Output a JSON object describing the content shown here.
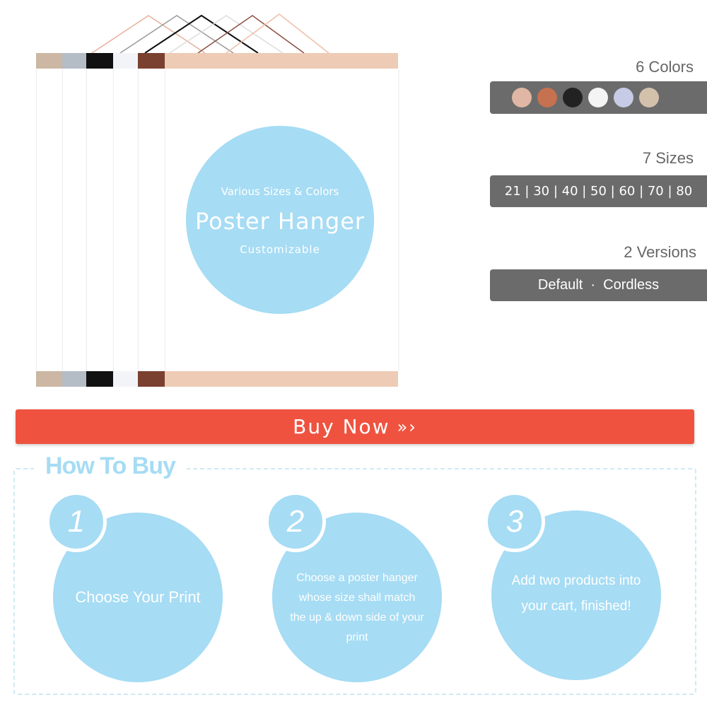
{
  "hero": {
    "subtitle": "Various Sizes & Colors",
    "title": "Poster Hanger",
    "tagline": "Customizable",
    "hanger_colors": [
      "#cbb7a3",
      "#b4bcc6",
      "#111111",
      "#f2f4f8",
      "#7a4030",
      "#eecbb5"
    ]
  },
  "options": {
    "colors": {
      "title": "6 Colors",
      "swatches": [
        "#e0b7a4",
        "#c6714f",
        "#222222",
        "#f4f4f4",
        "#c7cbe6",
        "#d3c1ac"
      ]
    },
    "sizes": {
      "title": "7 Sizes",
      "values": "21 | 30 | 40 | 50 | 60 | 70 | 80"
    },
    "versions": {
      "title": "2 Versions",
      "values": "Default  ·  Cordless"
    }
  },
  "buy_button": {
    "label": "Buy Now",
    "icon": "triple-chevron-right-icon",
    "color": "#ef5340"
  },
  "how_to_buy": {
    "title": "How To Buy",
    "steps": [
      {
        "number": "1",
        "text": "Choose Your Print"
      },
      {
        "number": "2",
        "text": "Choose a poster hanger whose size shall match the up & down side of your print"
      },
      {
        "number": "3",
        "text": "Add two products into your cart, finished!"
      }
    ]
  }
}
